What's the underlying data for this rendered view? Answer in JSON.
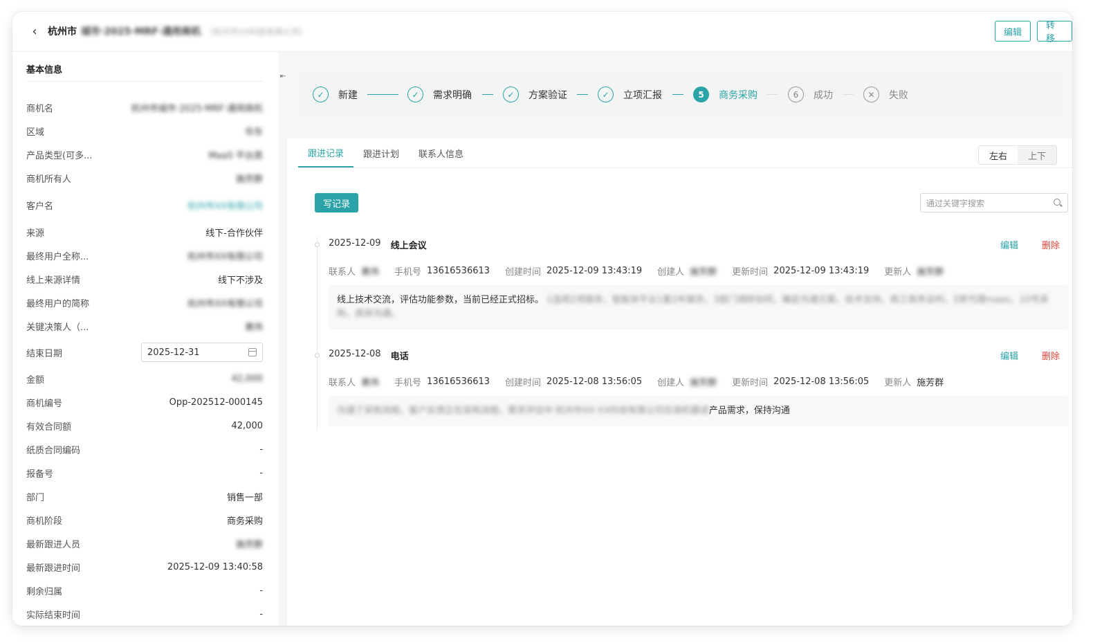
{
  "header": {
    "title": "杭州市",
    "title_hidden": "城市·2025·MRF·通用商机",
    "subtitle_hidden": "（杭州市XX科技有限公司）",
    "edit_label": "编辑",
    "transfer_label": "转移"
  },
  "basic": {
    "section_title": "基本信息",
    "rows": [
      {
        "label": "商机名",
        "value": "杭州市城市·2025·MRF·通用商机"
      },
      {
        "label": "区域",
        "value": "华东"
      },
      {
        "label": "产品类型(可多...",
        "value": "MaaS 平台类"
      },
      {
        "label": "商机所有人",
        "value": "施芳群"
      },
      {
        "label": "客户名",
        "value": "杭州市XX有限公司"
      },
      {
        "label": "来源",
        "value": "线下-合作伙伴"
      },
      {
        "label": "最终用户全称...",
        "value": "杭州市XX有限公司"
      },
      {
        "label": "线上来源详情",
        "value": "线下不涉及"
      },
      {
        "label": "最终用户的简称",
        "value": "杭州市XX有限公司"
      },
      {
        "label": "关键决策人（...",
        "value": "黄伟"
      },
      {
        "label": "结束日期",
        "value": "2025-12-31"
      },
      {
        "label": "金额",
        "value": "42,000"
      },
      {
        "label": "商机编号",
        "value": "Opp-202512-000145"
      },
      {
        "label": "有效合同额",
        "value": "42,000"
      },
      {
        "label": "纸质合同编码",
        "value": "-"
      },
      {
        "label": "报备号",
        "value": "-"
      },
      {
        "label": "部门",
        "value": "销售一部"
      },
      {
        "label": "商机阶段",
        "value": "商务采购"
      },
      {
        "label": "最新跟进人员",
        "value": "施芳群"
      },
      {
        "label": "最新跟进时间",
        "value": "2025-12-09 13:40:58"
      },
      {
        "label": "剩余归属",
        "value": "-"
      },
      {
        "label": "实际结束时间",
        "value": "-"
      }
    ]
  },
  "steps": [
    {
      "label": "新建",
      "status": "done",
      "mark": "✓"
    },
    {
      "label": "需求明确",
      "status": "done",
      "mark": "✓"
    },
    {
      "label": "方案验证",
      "status": "done",
      "mark": "✓"
    },
    {
      "label": "立项汇报",
      "status": "done",
      "mark": "✓"
    },
    {
      "label": "商务采购",
      "status": "active",
      "mark": "5"
    },
    {
      "label": "成功",
      "status": "pending",
      "mark": "6"
    },
    {
      "label": "失败",
      "status": "pending",
      "mark": "✕"
    }
  ],
  "tabs": [
    "跟进记录",
    "跟进计划",
    "联系人信息"
  ],
  "layout_toggle": [
    "左右",
    "上下"
  ],
  "write_label": "写记录",
  "search": {
    "placeholder": "通过关键字搜索"
  },
  "actions": {
    "edit": "编辑",
    "delete": "删除"
  },
  "meta_labels": {
    "contact": "联系人",
    "phone": "手机号",
    "created": "创建时间",
    "creator": "创建人",
    "updated": "更新时间",
    "updater": "更新人"
  },
  "records": [
    {
      "date": "2025-12-09",
      "type": "线上会议",
      "contact": "黄伟",
      "phone": "13616536613",
      "created": "2025-12-09 13:43:19",
      "creator": "施芳群",
      "updated": "2025-12-09 13:43:19",
      "updater": "施芳群",
      "content_visible": "线上技术交流，评估功能参数，当前已经正式招标。",
      "content_hidden": "1选用2项服务，智能体平台1套2年服务，3部门调研协同，确定沟通方案，技术支持，商工商务谈判，3家代理maas，10号采购，具体沟通。"
    },
    {
      "date": "2025-12-08",
      "type": "电话",
      "contact": "黄伟",
      "phone": "13616536613",
      "created": "2025-12-08 13:56:05",
      "creator": "施芳群",
      "updated": "2025-12-08 13:56:05",
      "updater": "施芳群",
      "content_hidden": "沟通了采购流程，客户反馈正在采购流程，需求评估中·杭州市XX·XX科技有限公司在商机跟进",
      "content_visible": "产品需求，保持沟通"
    }
  ]
}
